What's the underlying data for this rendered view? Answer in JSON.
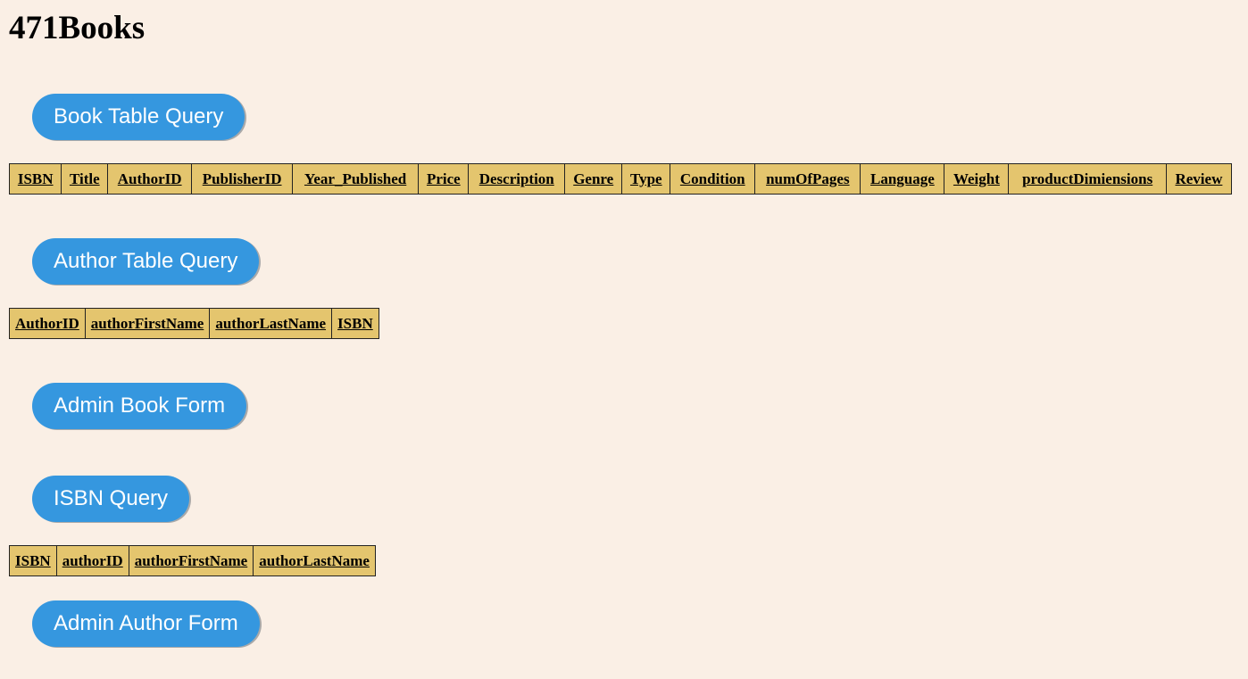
{
  "site": {
    "title": "471Books"
  },
  "book_query_button": "Book Table Query",
  "book_table_headers": [
    "ISBN",
    "Title",
    "AuthorID",
    "PublisherID",
    "Year_Published",
    "Price",
    "Description",
    "Genre",
    "Type",
    "Condition",
    "numOfPages",
    "Language",
    "Weight",
    "productDimiensions",
    "Review"
  ],
  "author_query_button": "Author Table Query",
  "author_table_headers": [
    "AuthorID",
    "authorFirstName",
    "authorLastName",
    "ISBN"
  ],
  "admin_book_button": "Admin Book Form",
  "isbn_query_button": "ISBN Query",
  "isbn_table_headers": [
    "ISBN",
    "authorID",
    "authorFirstName",
    "authorLastName"
  ],
  "admin_author_button": "Admin Author Form",
  "colors": {
    "background": "#faefe5",
    "button": "#3597df",
    "table_header": "#e4c56e"
  }
}
